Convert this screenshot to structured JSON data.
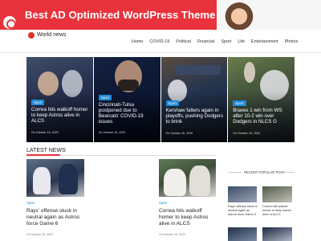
{
  "ad": {
    "text": "Best AD Optimized WordPress Theme"
  },
  "header": {
    "site_name": "World news",
    "nav": [
      "Home",
      "COVID-19",
      "Political",
      "Financial",
      "Sport",
      "Life",
      "Entertainment",
      "Photos"
    ]
  },
  "featured": [
    {
      "tag": "Sport",
      "title": "Correa hits walkoff homer to keep Astros alive in ALCS",
      "date": "On October 16, 2020"
    },
    {
      "tag": "Sport",
      "title": "Cincinnati-Tulsa postponed due to Bearcats' COVID-19 issues",
      "date": "On October 16, 2020"
    },
    {
      "tag": "Sport",
      "title": "Kershaw falters again in playoffs, pushing Dodgers to brink",
      "date": "On October 16, 2020"
    },
    {
      "tag": "Sport",
      "title": "Braves 1 win from WS after 10-2 win over Dodgers in NLCS G",
      "date": "On October 16, 2020"
    }
  ],
  "latest": {
    "heading": "LATEST NEWS",
    "cards": [
      {
        "tag": "Sport",
        "title": "Rays' offense stuck in neutral again as Astros force Game 6",
        "date": "On October 16, 2020"
      },
      {
        "tag": "Sport",
        "title": "Correa hits walkoff homer to keep Astros alive in ALCS",
        "date": "On October 16, 2020"
      }
    ]
  },
  "sidebar": {
    "heading": "RECENT POPULAR POST",
    "items": [
      {
        "title": "Rays' offense stuck in neutral again as Astros force Game 6"
      },
      {
        "title": "Correa hits walkoff homer to keep Astros alive in ALCS"
      }
    ]
  },
  "colors": {
    "accent": "#e8333c",
    "tag": "#1f8bd6"
  }
}
